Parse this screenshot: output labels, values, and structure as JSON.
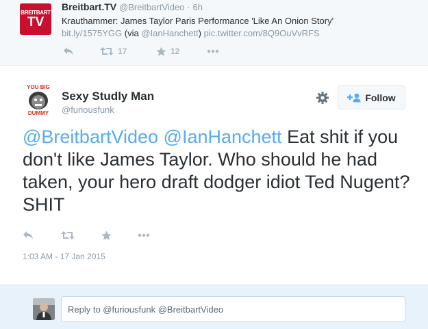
{
  "parent_tweet": {
    "avatar": {
      "line1": "BREITBART",
      "line2": "TV"
    },
    "name": "Breitbart.TV",
    "handle": "@BreitbartVideo",
    "separator": "·",
    "time": "6h",
    "text_line1": "Krauthammer: James Taylor Paris Performance 'Like An Onion Story'",
    "link": "bit.ly/1575YGG",
    "via_prefix": "(via ",
    "via_handle": "@IanHanchett",
    "via_suffix": ")",
    "pic": "pic.twitter.com/8Q9OuVvRFS",
    "retweet_count": "17",
    "favorite_count": "12"
  },
  "main_tweet": {
    "avatar": {
      "top_text": "YOU BIG",
      "bottom_text": "DUMMY"
    },
    "name": "Sexy Studly Man",
    "handle": "@furiousfunk",
    "follow_label": "Follow",
    "mention1": "@BreitbartVideo",
    "mention2": "@IanHanchett",
    "text": " Eat shit if you don't like James Taylor. Who should he had taken, your hero draft dodger idiot Ted Nugent? SHIT",
    "datetime": "1:03 AM - 17 Jan 2015"
  },
  "reply": {
    "placeholder": "Reply to @furiousfunk @BreitbartVideo"
  },
  "colors": {
    "link_blue": "#55acee",
    "muted": "#8899a6",
    "action_gray": "#aab8c2",
    "brand_red": "#c8102e"
  },
  "icons": [
    "reply-icon",
    "retweet-icon",
    "favorite-icon",
    "more-icon",
    "gear-icon",
    "follow-user-icon"
  ]
}
